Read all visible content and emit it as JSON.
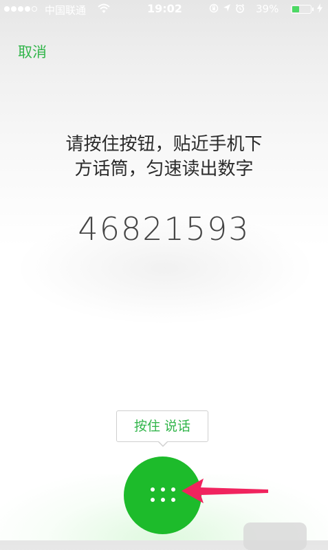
{
  "status_bar": {
    "carrier": "中国联通",
    "time": "19:02",
    "battery_percent": "39%",
    "battery_level": 0.39,
    "signal_bars_filled": 4,
    "signal_bars_total": 5,
    "icons": [
      "signal-dots-icon",
      "wifi-icon",
      "orientation-lock-icon",
      "location-icon",
      "alarm-icon",
      "battery-icon",
      "charging-icon"
    ]
  },
  "header": {
    "cancel_label": "取消"
  },
  "main": {
    "instruction_line1": "请按住按钮，贴近手机下",
    "instruction_line2": "方话筒，匀速读出数字",
    "digits": "46821593"
  },
  "hold_button": {
    "tooltip_label": "按住 说话",
    "icon": "six-dots-icon"
  },
  "annotation": {
    "icon": "pointer-arrow-icon"
  },
  "colors": {
    "accent": "#31b54a",
    "button": "#1dbb2b",
    "arrow": "#f0245e",
    "battery": "#4cd964"
  }
}
